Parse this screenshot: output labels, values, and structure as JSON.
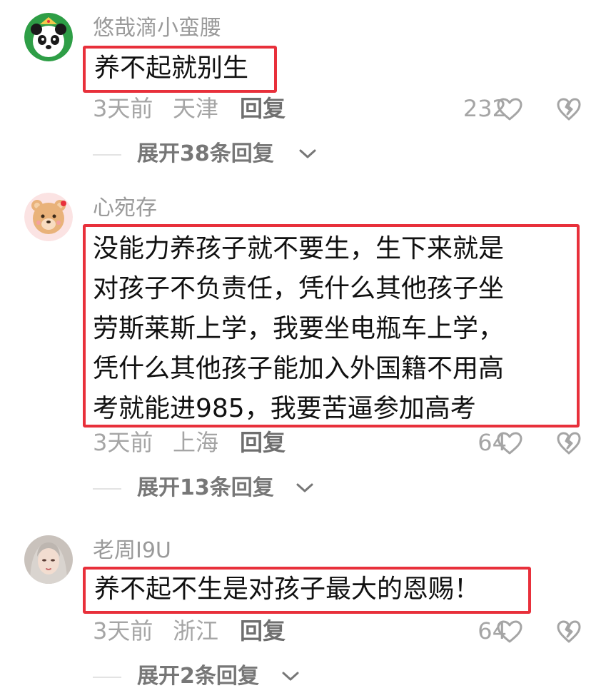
{
  "comments": [
    {
      "username": "悠哉滴小蛮腰",
      "lines": [
        "养不起就别生"
      ],
      "time": "3天前",
      "location": "天津",
      "reply": "回复",
      "likes": "232",
      "expand": "展开38条回复",
      "avatar_icon": "panda-avatar"
    },
    {
      "username": "心宛存",
      "lines": [
        "没能力养孩子就不要生，生下来就是",
        "对孩子不负责任，凭什么其他孩子坐",
        "劳斯莱斯上学，我要坐电瓶车上学，",
        "凭什么其他孩子能加入外国籍不用高",
        "考就能进985，我要苦逼参加高考"
      ],
      "time": "3天前",
      "location": "上海",
      "reply": "回复",
      "likes": "64",
      "expand": "展开13条回复",
      "avatar_icon": "bear-avatar"
    },
    {
      "username": "老周I9U",
      "lines": [
        "养不起不生是对孩子最大的恩赐！"
      ],
      "time": "3天前",
      "location": "浙江",
      "reply": "回复",
      "likes": "64",
      "expand": "展开2条回复",
      "avatar_icon": "portrait-avatar"
    }
  ],
  "colors": {
    "highlight_border": "#e8303b",
    "muted_text": "#a5a5a5",
    "username_text": "#9a9a9a"
  }
}
